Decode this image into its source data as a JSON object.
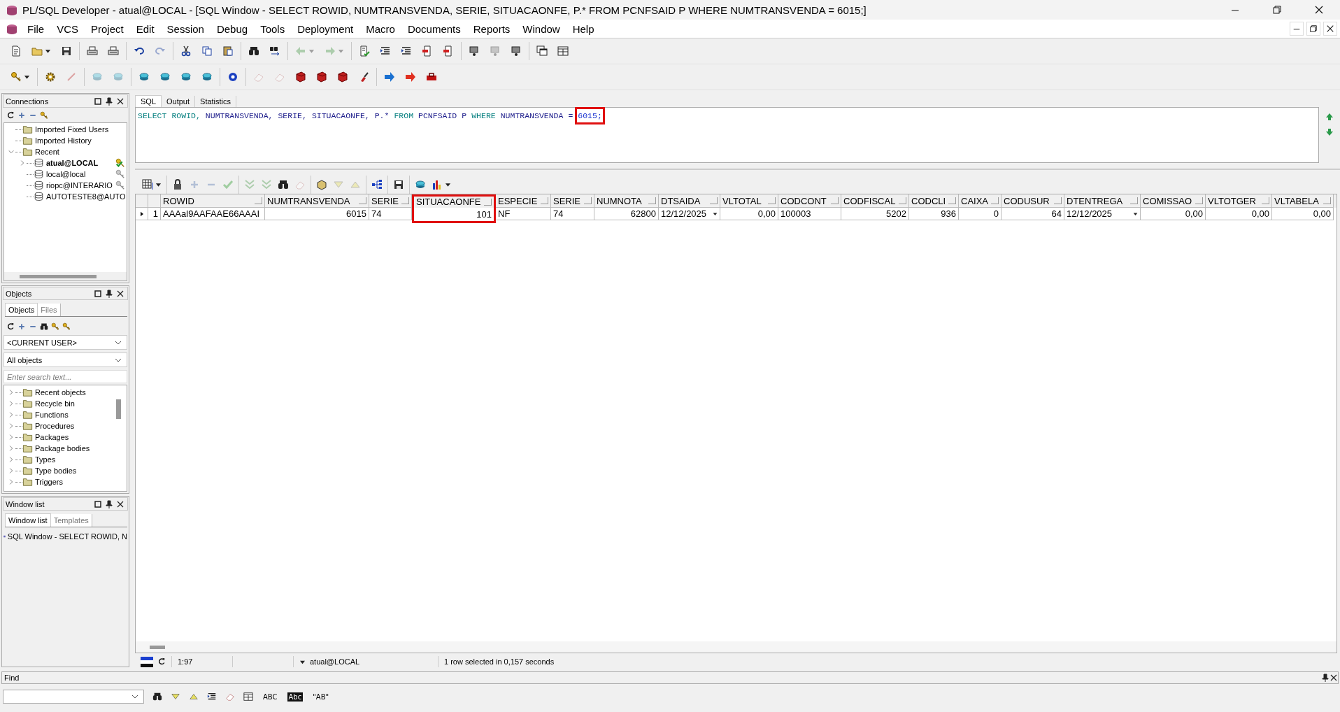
{
  "window": {
    "title": "PL/SQL Developer - atual@LOCAL - [SQL Window - SELECT ROWID, NUMTRANSVENDA, SERIE, SITUACAONFE, P.* FROM PCNFSAID P WHERE NUMTRANSVENDA = 6015;]"
  },
  "menu": [
    "File",
    "VCS",
    "Project",
    "Edit",
    "Session",
    "Debug",
    "Tools",
    "Deployment",
    "Macro",
    "Documents",
    "Reports",
    "Window",
    "Help"
  ],
  "main_toolbar": [
    {
      "disabled": false
    },
    {
      "disabled": false
    },
    {
      "disabled": false
    },
    {
      "disabled": false
    },
    {
      "disabled": false
    },
    {
      "disabled": false
    },
    {
      "disabled": true
    },
    {
      "disabled": false
    },
    {
      "disabled": false
    },
    {
      "disabled": false
    },
    {
      "disabled": false
    },
    {
      "disabled": false
    },
    {
      "disabled": true
    },
    {
      "disabled": true
    },
    {
      "disabled": false
    },
    {
      "disabled": false
    },
    {
      "disabled": false
    },
    {
      "disabled": false
    },
    {
      "disabled": false
    },
    {
      "disabled": false
    },
    {
      "disabled": true
    },
    {
      "disabled": false
    },
    {
      "disabled": false
    },
    {
      "disabled": false
    }
  ],
  "secondary_toolbar": [
    {
      "disabled": false
    },
    {
      "disabled": false
    },
    {
      "disabled": true
    },
    {
      "disabled": true
    },
    {
      "disabled": true
    },
    {
      "disabled": false
    },
    {
      "disabled": false
    },
    {
      "disabled": false
    },
    {
      "disabled": false
    },
    {
      "disabled": false
    },
    {
      "disabled": true
    },
    {
      "disabled": true
    },
    {
      "disabled": false
    },
    {
      "disabled": false
    },
    {
      "disabled": false
    },
    {
      "disabled": false
    },
    {
      "disabled": false
    },
    {
      "disabled": false
    },
    {
      "disabled": false
    }
  ],
  "connections": {
    "title": "Connections",
    "tree": [
      {
        "label": "Imported Fixed Users",
        "kind": "folder"
      },
      {
        "label": "Imported History",
        "kind": "folder"
      },
      {
        "label": "Recent",
        "kind": "folder",
        "expanded": true,
        "children": [
          {
            "label": "atual@LOCAL",
            "kind": "connection",
            "active": true,
            "connected": true
          },
          {
            "label": "local@local",
            "kind": "connection",
            "active": false,
            "connected": false
          },
          {
            "label": "riopc@INTERARIO",
            "kind": "connection",
            "active": false,
            "connected": false
          },
          {
            "label": "AUTOTESTE8@AUTO",
            "kind": "connection",
            "active": false
          }
        ]
      }
    ]
  },
  "objects": {
    "title": "Objects",
    "tabs": [
      {
        "label": "Objects",
        "selected": true
      },
      {
        "label": "Files",
        "selected": false
      }
    ],
    "owner": "<CURRENT USER>",
    "filter": "All objects",
    "search": {
      "placeholder": "Enter search text..."
    },
    "tree": [
      {
        "label": "Recent objects",
        "expanded": false
      },
      {
        "label": "Recycle bin",
        "expanded": false
      },
      {
        "label": "Functions",
        "expanded": false
      },
      {
        "label": "Procedures",
        "expanded": false
      },
      {
        "label": "Packages",
        "expanded": false
      },
      {
        "label": "Package bodies",
        "expanded": false
      },
      {
        "label": "Types",
        "expanded": false
      },
      {
        "label": "Type bodies",
        "expanded": false
      },
      {
        "label": "Triggers",
        "expanded": false
      }
    ]
  },
  "window_list": {
    "title": "Window list",
    "tabs": [
      {
        "label": "Window list",
        "selected": true
      },
      {
        "label": "Templates",
        "selected": false
      }
    ],
    "items": [
      "SQL Window - SELECT ROWID, N"
    ]
  },
  "editor_tabs": [
    {
      "label": "SQL",
      "selected": true
    },
    {
      "label": "Output",
      "selected": false
    },
    {
      "label": "Statistics",
      "selected": false
    }
  ],
  "sql": [
    {
      "text": "SELECT",
      "kind": "keyword"
    },
    {
      "text": "ROWID,",
      "kind": "keyword"
    },
    {
      "text": "NUMTRANSVENDA,",
      "kind": "ident"
    },
    {
      "text": "SERIE,",
      "kind": "ident"
    },
    {
      "text": "SITUACAONFE,",
      "kind": "ident"
    },
    {
      "text": "P.*",
      "kind": "ident"
    },
    {
      "text": "FROM",
      "kind": "keyword"
    },
    {
      "text": "PCNFSAID",
      "kind": "ident"
    },
    {
      "text": "P",
      "kind": "ident"
    },
    {
      "text": "WHERE",
      "kind": "keyword"
    },
    {
      "text": "NUMTRANSVENDA",
      "kind": "ident"
    },
    {
      "text": "=",
      "kind": "ident"
    },
    {
      "text": "6015;",
      "kind": "number",
      "highlighted": true
    }
  ],
  "grid_toolbar": [
    {
      "disabled": false
    },
    {
      "disabled": false
    },
    {
      "disabled": true
    },
    {
      "disabled": true
    },
    {
      "disabled": true
    },
    {
      "disabled": true
    },
    {
      "disabled": true
    },
    {
      "disabled": false
    },
    {
      "disabled": true
    },
    {
      "disabled": false
    },
    {
      "disabled": true
    },
    {
      "disabled": true
    },
    {
      "disabled": false
    },
    {
      "disabled": false
    },
    {
      "disabled": false
    },
    {
      "disabled": false
    }
  ],
  "grid": {
    "columns": [
      {
        "label": "ROWID",
        "kind": "text"
      },
      {
        "label": "NUMTRANSVENDA",
        "kind": "number"
      },
      {
        "label": "SERIE",
        "kind": "text"
      },
      {
        "label": "SITUACAONFE",
        "kind": "number",
        "highlighted": true
      },
      {
        "label": "ESPECIE",
        "kind": "text"
      },
      {
        "label": "SERIE",
        "kind": "text"
      },
      {
        "label": "NUMNOTA",
        "kind": "number"
      },
      {
        "label": "DTSAIDA",
        "kind": "date"
      },
      {
        "label": "VLTOTAL",
        "kind": "number"
      },
      {
        "label": "CODCONT",
        "kind": "text"
      },
      {
        "label": "CODFISCAL",
        "kind": "number"
      },
      {
        "label": "CODCLI",
        "kind": "number"
      },
      {
        "label": "CAIXA",
        "kind": "number"
      },
      {
        "label": "CODUSUR",
        "kind": "number"
      },
      {
        "label": "DTENTREGA",
        "kind": "date"
      },
      {
        "label": "COMISSAO",
        "kind": "number"
      },
      {
        "label": "VLTOTGER",
        "kind": "number"
      },
      {
        "label": "VLTABELA",
        "kind": "number"
      }
    ],
    "rows": [
      {
        "number": "1",
        "selected": true,
        "cells": [
          "AAAal9AAFAAE66AAAI",
          "6015",
          "74",
          "101",
          "NF",
          "74",
          "62800",
          "12/12/2025",
          "0,00",
          "100003",
          "5202",
          "936",
          "0",
          "64",
          "12/12/2025",
          "0,00",
          "0,00",
          "0,00"
        ]
      }
    ]
  },
  "status_bar": {
    "position": "1:97",
    "connection": "atual@LOCAL",
    "message": "1 row selected in 0,157 seconds"
  },
  "find": {
    "title": "Find",
    "options": [
      {
        "text": "ABC",
        "kind": "plain"
      },
      {
        "text": "Abc",
        "kind": "inverse"
      },
      {
        "text": "\"AB\"",
        "kind": "plain"
      }
    ]
  }
}
